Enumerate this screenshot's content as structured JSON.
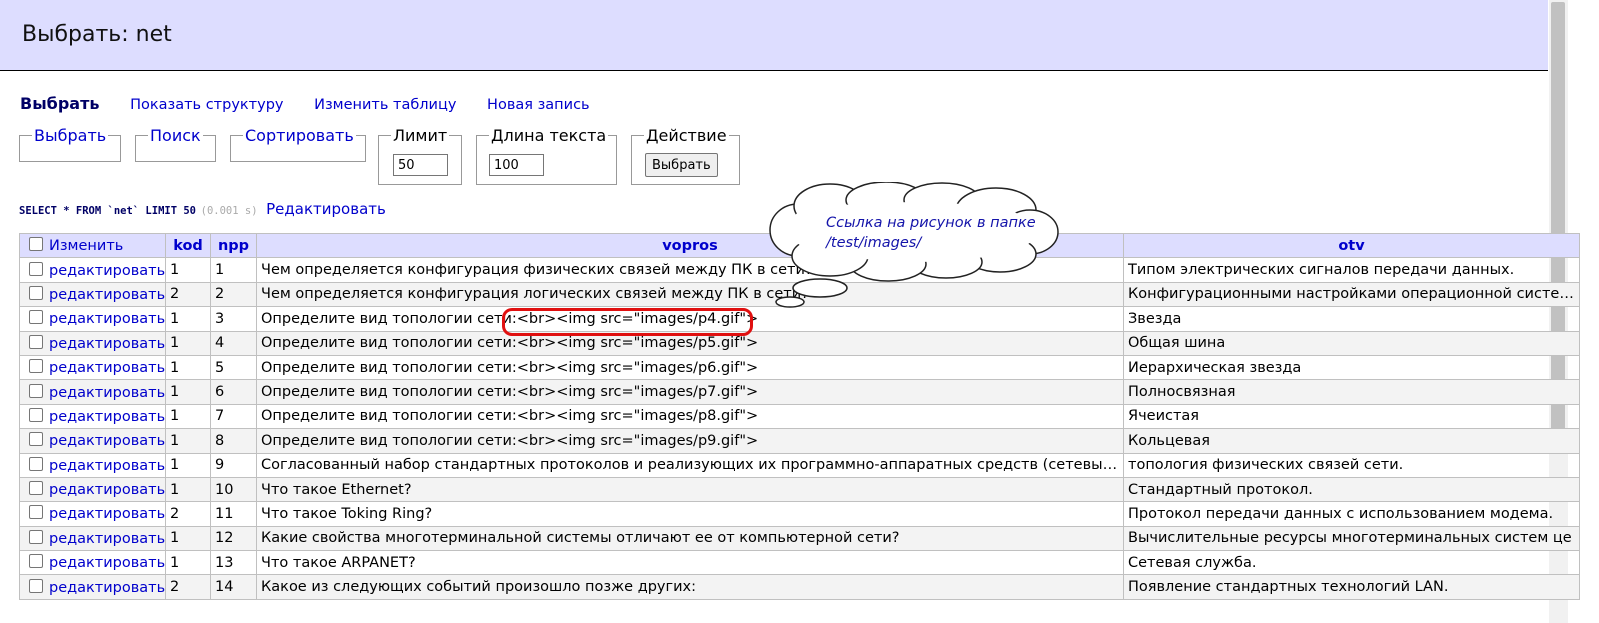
{
  "page": {
    "title": "Выбрать: net"
  },
  "menu": [
    {
      "label": "Выбрать",
      "active": true
    },
    {
      "label": "Показать структуру",
      "active": false
    },
    {
      "label": "Изменить таблицу",
      "active": false
    },
    {
      "label": "Новая запись",
      "active": false
    }
  ],
  "controls": {
    "select_legend": "Выбрать",
    "search_legend": "Поиск",
    "sort_legend": "Сортировать",
    "limit_legend": "Лимит",
    "limit_value": "50",
    "textlen_legend": "Длина текста",
    "textlen_value": "100",
    "action_legend": "Действие",
    "action_button": "Выбрать"
  },
  "query": {
    "sql": "SELECT * FROM `net` LIMIT 50",
    "time": "(0.001 s)",
    "edit_link": "Редактировать"
  },
  "table": {
    "headers": {
      "modify": "Изменить",
      "kod": "kod",
      "npp": "npp",
      "vopros": "vopros",
      "otv": "otv"
    },
    "edit_label": "редактировать",
    "rows": [
      {
        "kod": "1",
        "npp": "1",
        "vopros": "Чем определяется конфигурация физических связей между ПК в сети?",
        "otv": "Типом электрических сигналов передачи данных."
      },
      {
        "kod": "2",
        "npp": "2",
        "vopros": "Чем определяется конфигурация логических связей между ПК в сети?",
        "otv": "Конфигурационными настройками операционной системы"
      },
      {
        "kod": "1",
        "npp": "3",
        "vopros": "Определите вид топологии сети:<br><img src=\"images/p4.gif\">",
        "otv": "Звезда"
      },
      {
        "kod": "1",
        "npp": "4",
        "vopros": "Определите вид топологии сети:<br><img src=\"images/p5.gif\">",
        "otv": "Общая шина"
      },
      {
        "kod": "1",
        "npp": "5",
        "vopros": "Определите вид топологии сети:<br><img src=\"images/p6.gif\">",
        "otv": "Иерархическая звезда"
      },
      {
        "kod": "1",
        "npp": "6",
        "vopros": "Определите вид топологии сети:<br><img src=\"images/p7.gif\">",
        "otv": "Полносвязная"
      },
      {
        "kod": "1",
        "npp": "7",
        "vopros": "Определите вид топологии сети:<br><img src=\"images/p8.gif\">",
        "otv": "Ячеистая"
      },
      {
        "kod": "1",
        "npp": "8",
        "vopros": "Определите вид топологии сети:<br><img src=\"images/p9.gif\">",
        "otv": "Кольцевая"
      },
      {
        "kod": "1",
        "npp": "9",
        "vopros": "Согласованный набор стандартных протоколов и реализующих их программно-аппаратных средств (сетевых а…",
        "otv": "топология физических связей сети."
      },
      {
        "kod": "1",
        "npp": "10",
        "vopros": "Что такое Ethernet?",
        "otv": "Стандартный протокол."
      },
      {
        "kod": "2",
        "npp": "11",
        "vopros": "Что такое Toking Ring?",
        "otv": "Протокол передачи данных с использованием модема."
      },
      {
        "kod": "1",
        "npp": "12",
        "vopros": "Какие свойства многотерминальной системы отличают ее от компьютерной сети?",
        "otv": "Вычислительные ресурсы многотерминальных систем це"
      },
      {
        "kod": "1",
        "npp": "13",
        "vopros": "Что такое ARPANET?",
        "otv": "Сетевая служба."
      },
      {
        "kod": "2",
        "npp": "14",
        "vopros": "Какое из следующих событий произошло позже других:",
        "otv": "Появление стандартных технологий LAN."
      }
    ]
  },
  "callout": {
    "text": "Ссылка на рисунок в папке /test/images/"
  }
}
